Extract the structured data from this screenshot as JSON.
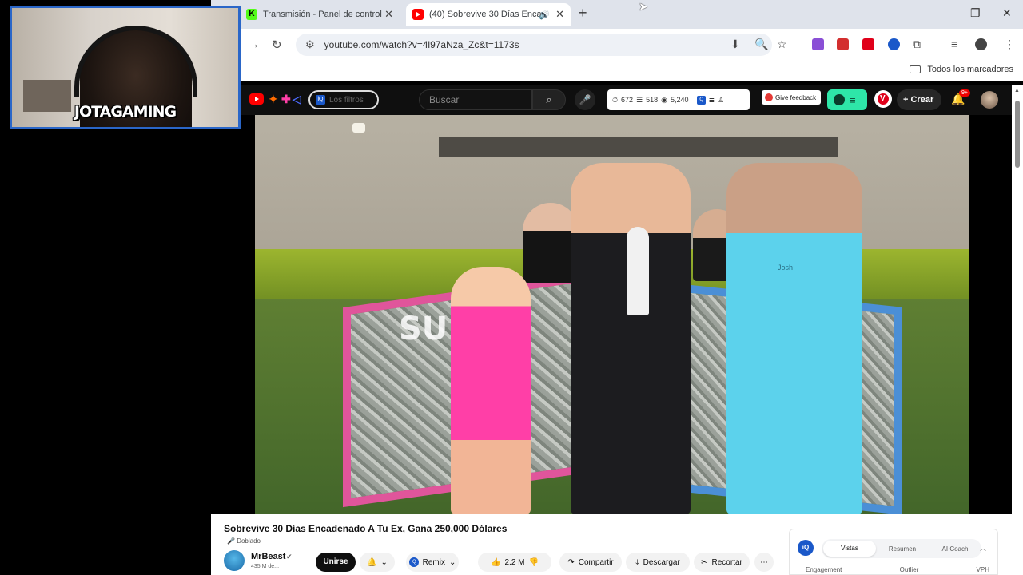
{
  "webcam": {
    "overlay_name": "JOTAGAMING"
  },
  "browser": {
    "tabs": [
      {
        "title": "Transmisión - Panel de control d",
        "favicon": "kick-logo",
        "active": false
      },
      {
        "title": "(40) Sobrevive 30 Días Enca",
        "favicon": "youtube-logo",
        "active": true,
        "audio": true
      }
    ],
    "new_tab": "+",
    "url": "youtube.com/watch?v=4l97aNza_Zc&t=1173s",
    "bookmarks_label": "Todos los marcadores"
  },
  "youtube": {
    "filter_pill": "Los filtros",
    "search_placeholder": "Buscar",
    "stats": {
      "likes": "672",
      "comments": "518",
      "views": "5,240"
    },
    "feedback_label": "Give feedback",
    "v_label": "V",
    "create_label": "Crear",
    "notif_badge": "9+"
  },
  "video": {
    "overlay_text": "SU",
    "shirt_label": "Josh",
    "title": "Sobrevive 30 Días Encadenado A Tu Ex, Gana 250,000 Dólares",
    "dubbed_label": "Doblado",
    "channel": {
      "name": "MrBeast",
      "subscribers": "435 M de..."
    },
    "join_label": "Unirse",
    "remix_label": "Remix",
    "likes": "2.2 M",
    "share_label": "Compartir",
    "download_label": "Descargar",
    "clip_label": "Recortar"
  },
  "vidiq_panel": {
    "tabs": [
      "Vistas",
      "Resumen",
      "AI Coach"
    ],
    "active_tab": "Vistas",
    "metrics": [
      "Engagement",
      "Outlier",
      "VPH"
    ]
  },
  "colors": {
    "webcam_border": "#2a66c8",
    "youtube_red": "#ff0000",
    "kick_green": "#53fc18",
    "vidiq_blue": "#1a58c9",
    "green_button": "#2ee6a8"
  }
}
